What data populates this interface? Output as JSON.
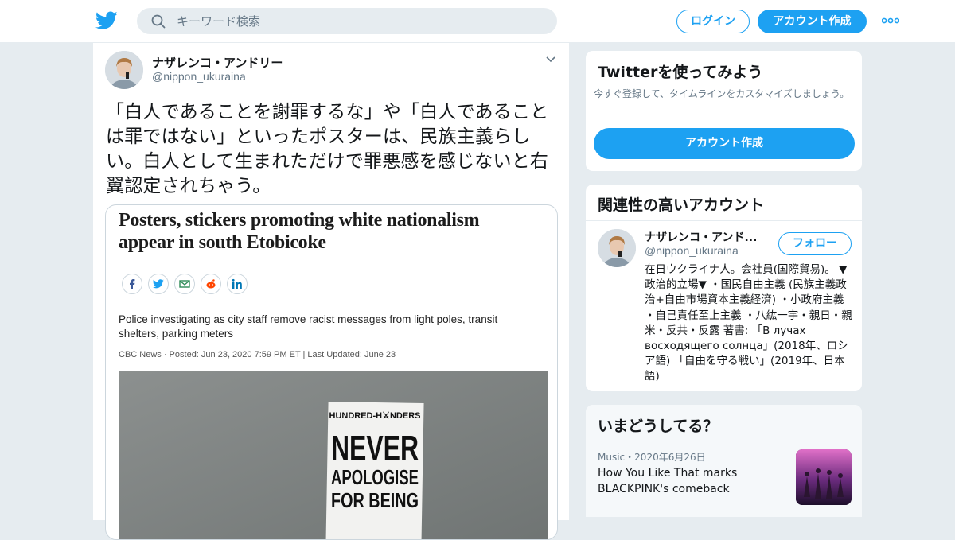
{
  "colors": {
    "accent": "#1da1f2",
    "page_background": "#e6ecf0",
    "secondary_text": "#657786"
  },
  "header": {
    "logo_icon": "twitter-bird-icon",
    "search_placeholder": "キーワード検索",
    "login_label": "ログイン",
    "signup_label": "アカウント作成",
    "more_icon": "more-dots-icon"
  },
  "tweet": {
    "author_name": "ナザレンコ・アンドリー",
    "author_handle": "@nippon_ukuraina",
    "text": "「白人であることを謝罪するな」や「白人であることは罪ではない」といったポスターは、民族主義らしい。白人として生まれただけで罪悪感を感じないと右翼認定されちゃう。",
    "media": {
      "headline": "Posters, stickers promoting white nationalism appear in south Etobicoke",
      "subheadline": "Police investigating as city staff remove racist messages from light poles, transit shelters, parking meters",
      "meta": "CBC News · Posted: Jun 23, 2020 7:59 PM ET | Last Updated: June 23",
      "share_icons": [
        "facebook-icon",
        "twitter-icon",
        "email-icon",
        "reddit-icon",
        "linkedin-icon"
      ],
      "poster": {
        "brand": "HUNDRED-H⚔NDERS",
        "line1": "NEVER",
        "line2": "APOLOGISE",
        "line3": "FOR BEING"
      }
    }
  },
  "signup_card": {
    "title": "Twitterを使ってみよう",
    "description": "今すぐ登録して、タイムラインをカスタマイズしましょう。",
    "button_label": "アカウント作成"
  },
  "related_card": {
    "title": "関連性の高いアカウント",
    "name": "ナザレンコ・アンド...",
    "handle": "@nippon_ukuraina",
    "follow_label": "フォロー",
    "bio": "在日ウクライナ人。会社員(国際貿易)。 ▼政治的立場▼ ・国民自由主義 (民族主義政治+自由市場資本主義経済) ・小政府主義 ・自己責任至上主義 ・八紘一宇・親日・親米・反共・反露 著書: 「В лучах восходящего солнца」(2018年、ロシア語) 「自由を守る戦い」(2019年、日本語)"
  },
  "trends_card": {
    "title": "いまどうしてる？",
    "category": "Music",
    "dot": "・",
    "date": "2020年6月26日",
    "headline": "How You Like That marks BLACKPINK's comeback"
  }
}
